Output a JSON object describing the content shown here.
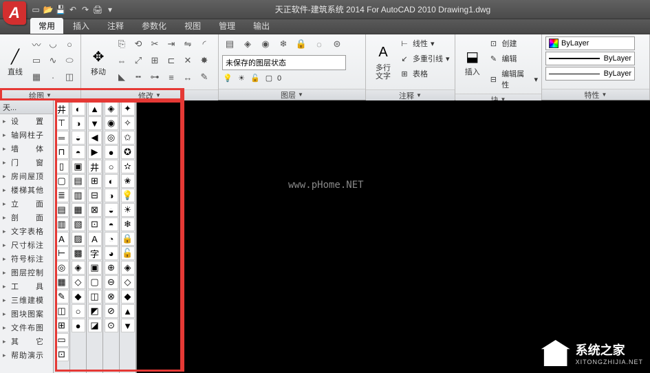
{
  "title": "天正软件-建筑系统 2014  For AutoCAD 2010    Drawing1.dwg",
  "tabs": [
    "常用",
    "插入",
    "注释",
    "参数化",
    "视图",
    "管理",
    "输出"
  ],
  "ribbon": {
    "draw_panel": "绘图",
    "modify_panel": "修改",
    "layer_panel": "图层",
    "annotate_panel": "注释",
    "block_panel": "块",
    "props_panel": "特性",
    "line": "直线",
    "move": "移动",
    "unsaved_layer": "未保存的图层状态",
    "current_layer": "0",
    "mtext": "多行\n文字",
    "linetype": "线性",
    "mleader": "多重引线",
    "table": "表格",
    "insert": "插入",
    "create": "创建",
    "edit": "编辑",
    "editattr": "编辑属性",
    "bylayer": "ByLayer"
  },
  "sidebar": {
    "title": "天...",
    "items": [
      "设　　置",
      "轴网柱子",
      "墙　　体",
      "门　　窗",
      "房间屋顶",
      "楼梯其他",
      "立　　面",
      "剖　　面",
      "文字表格",
      "尺寸标注",
      "符号标注",
      "图层控制",
      "工　　具",
      "三维建模",
      "图块图案",
      "文件布图",
      "其　　它",
      "帮助演示"
    ]
  },
  "watermark": {
    "url": "www.pHome.NET",
    "brand": "系统之家",
    "sub": "XITONGZHIJIA.NET"
  }
}
